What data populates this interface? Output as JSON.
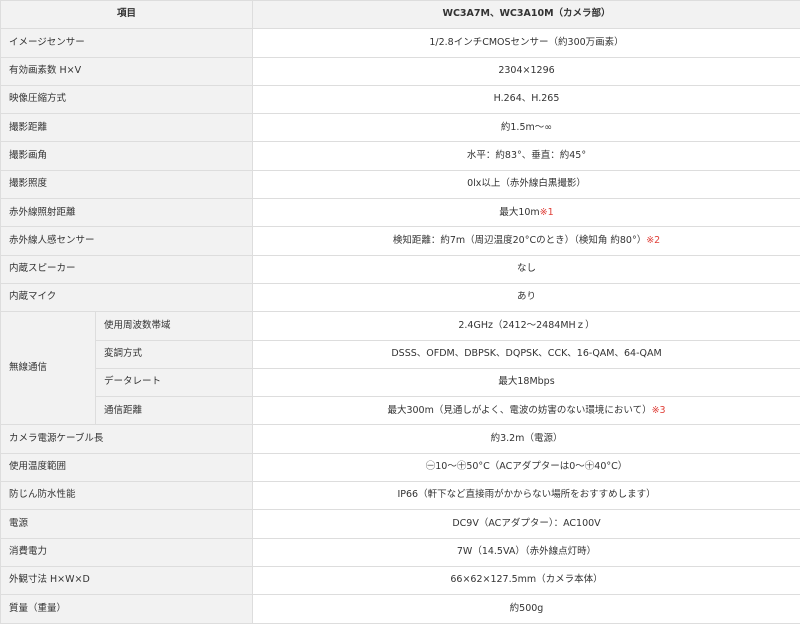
{
  "header": {
    "item": "項目",
    "model": "WC3A7M、WC3A10M（カメラ部）"
  },
  "rows": [
    {
      "label": "イメージセンサー",
      "value": "1/2.8インチCMOSセンサー（約300万画素）"
    },
    {
      "label": "有効画素数 H×V",
      "value": "2304×1296"
    },
    {
      "label": "映像圧縮方式",
      "value": "H.264、H.265"
    },
    {
      "label": "撮影距離",
      "value": "約1.5m～∞"
    },
    {
      "label": "撮影画角",
      "value": "水平：約83°、垂直：約45°"
    },
    {
      "label": "撮影照度",
      "value": "0lx以上（赤外線白黒撮影）"
    },
    {
      "label": "赤外線照射距離",
      "value": "最大10m",
      "note": "※1"
    },
    {
      "label": "赤外線人感センサー",
      "value": "検知距離：約7m（周辺温度20°Cのとき）（検知角 約80°）",
      "note": "※2"
    },
    {
      "label": "内蔵スピーカー",
      "value": "なし"
    },
    {
      "label": "内蔵マイク",
      "value": "あり"
    }
  ],
  "wireless": {
    "label": "無線通信",
    "rows": [
      {
        "label": "使用周波数帯域",
        "value": "2.4GHz（2412～2484MHｚ）"
      },
      {
        "label": "変調方式",
        "value": "DSSS、OFDM、DBPSK、DQPSK、CCK、16-QAM、64-QAM"
      },
      {
        "label": "データレート",
        "value": "最大18Mbps"
      },
      {
        "label": "通信距離",
        "value": "最大300m（見通しがよく、電波の妨害のない環境において）",
        "note": "※3"
      }
    ]
  },
  "rows2": [
    {
      "label": "カメラ電源ケーブル長",
      "value": "約3.2m（電源）"
    },
    {
      "label": "使用温度範囲",
      "value": "㊀10～㊉50°C（ACアダプターは0～㊉40°C）"
    },
    {
      "label": "防じん防水性能",
      "value": "IP66（軒下など直接雨がかからない場所をおすすめします）"
    },
    {
      "label": "電源",
      "value": "DC9V（ACアダプター）：AC100V"
    },
    {
      "label": "消費電力",
      "value": "7W（14.5VA）（赤外線点灯時）"
    },
    {
      "label": "外観寸法 H×W×D",
      "value": "66×62×127.5mm（カメラ本体）"
    },
    {
      "label": "質量（重量）",
      "value": "約500g"
    }
  ]
}
